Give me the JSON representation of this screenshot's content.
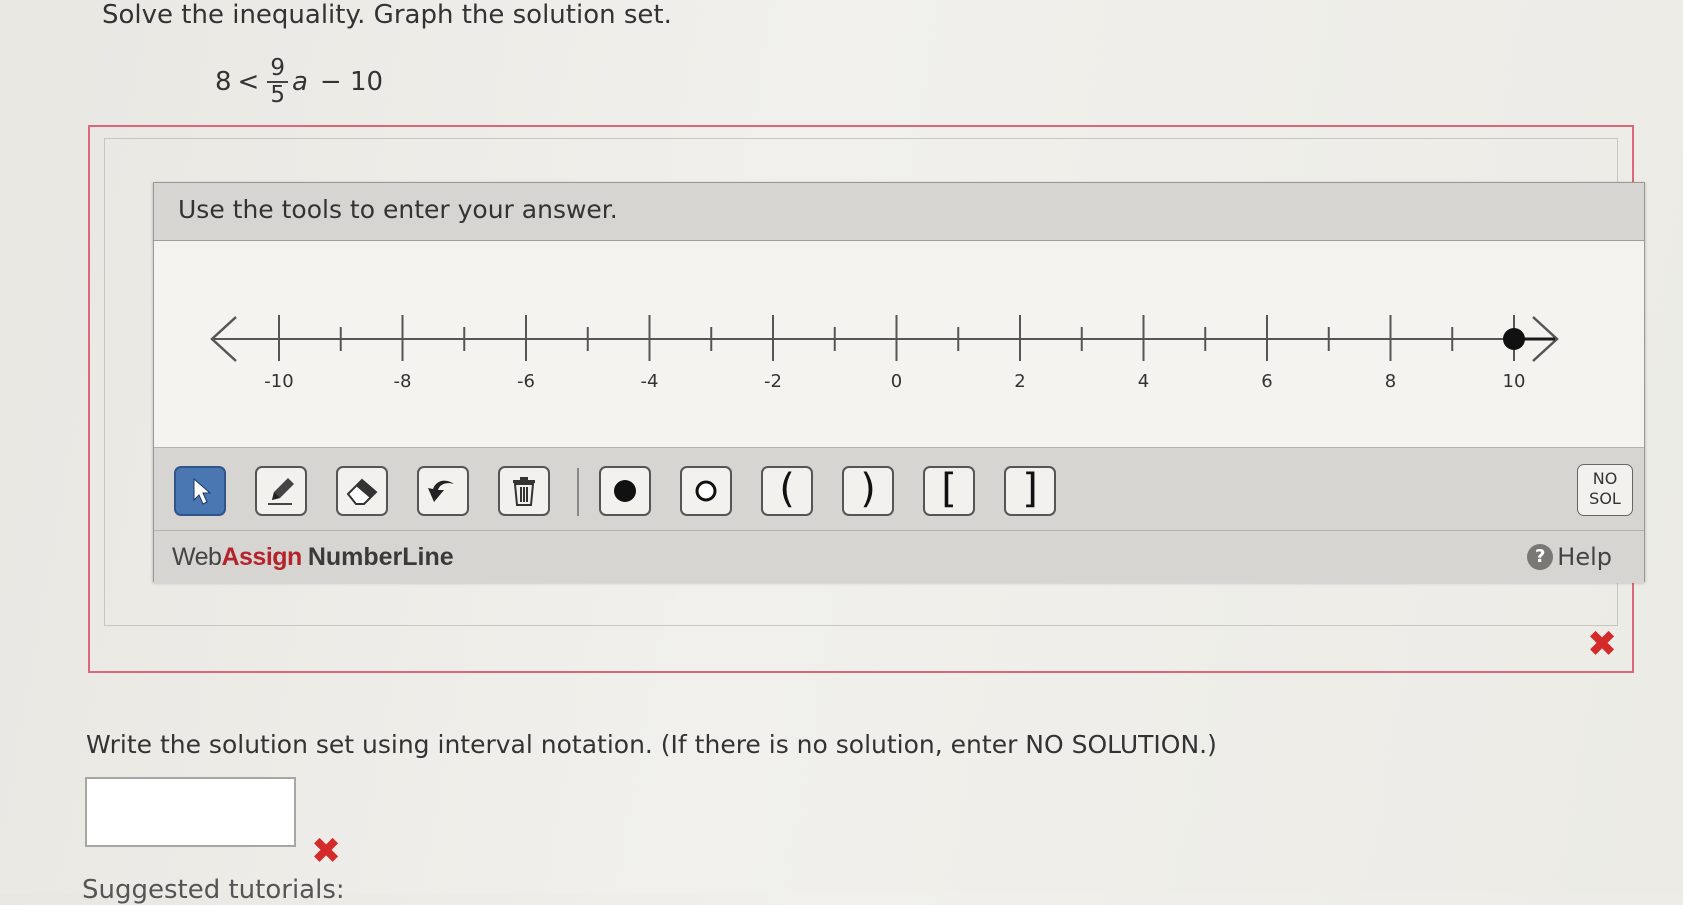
{
  "question": {
    "instruction": "Solve the inequality. Graph the solution set.",
    "inequality": {
      "lhs": "8",
      "relation": "<",
      "numerator": "9",
      "denominator": "5",
      "variable": "a",
      "rest": "− 10"
    }
  },
  "widget": {
    "header": "Use the tools to enter your answer.",
    "numberline": {
      "min": -10,
      "max": 10,
      "tick_step": 1,
      "labels": [
        "-10",
        "-8",
        "-6",
        "-4",
        "-2",
        "0",
        "2",
        "4",
        "6",
        "8",
        "10"
      ],
      "plotted_point": {
        "value": 10,
        "type": "closed"
      },
      "arrow_right_highlighted": true
    },
    "tools": [
      {
        "name": "pointer-tool",
        "icon": "pointer-icon",
        "active": true
      },
      {
        "name": "pencil-tool",
        "icon": "pencil-icon"
      },
      {
        "name": "eraser-tool",
        "icon": "eraser-icon"
      },
      {
        "name": "undo-tool",
        "icon": "undo-icon"
      },
      {
        "name": "trash-tool",
        "icon": "trash-icon"
      },
      {
        "name": "closed-dot-tool",
        "icon": "filled-circle-icon"
      },
      {
        "name": "open-dot-tool",
        "icon": "open-circle-icon"
      },
      {
        "name": "left-paren-tool",
        "label": "("
      },
      {
        "name": "right-paren-tool",
        "label": ")"
      },
      {
        "name": "left-bracket-tool",
        "label": "["
      },
      {
        "name": "right-bracket-tool",
        "label": "]"
      }
    ],
    "nosol": {
      "line1": "NO",
      "line2": "SOL"
    },
    "footer": {
      "brand_web": "Web",
      "brand_assign": "Assign",
      "brand_product": "NumberLine",
      "help_label": "Help",
      "help_icon": "?"
    }
  },
  "status": {
    "graph_mark": "✖",
    "answer_mark": "✖",
    "color": "#d42a2a"
  },
  "part2": {
    "prompt": "Write the solution set using interval notation. (If there is no solution, enter NO SOLUTION.)",
    "answer_value": "",
    "answer_placeholder": ""
  },
  "tutorials_label": "Suggested tutorials:"
}
